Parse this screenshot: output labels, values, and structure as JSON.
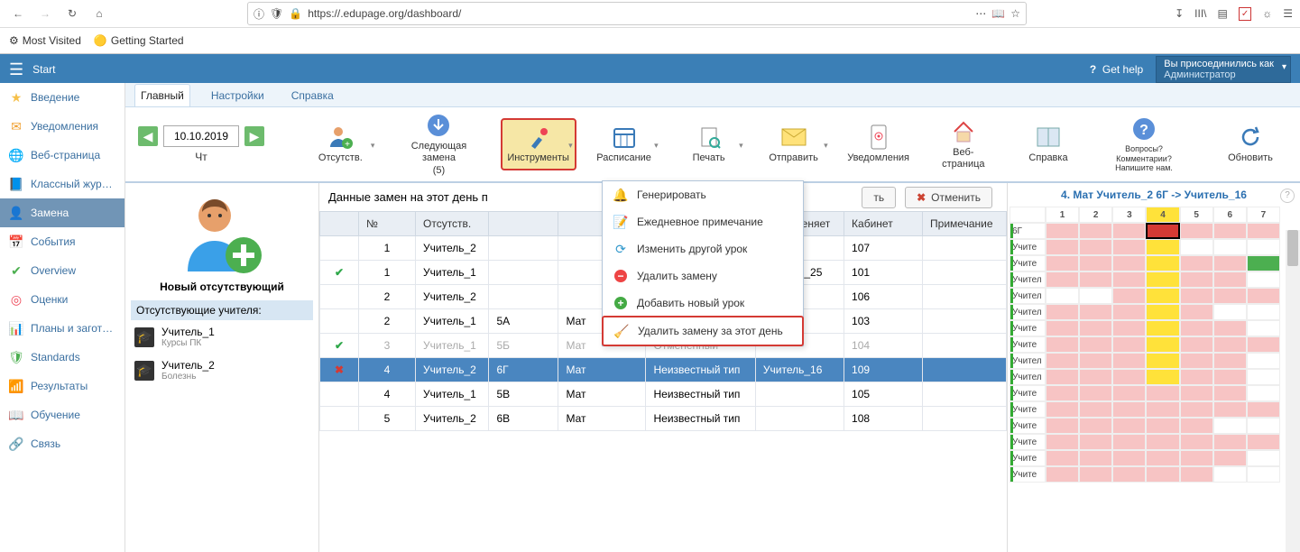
{
  "browser": {
    "url": "https://.edupage.org/dashboard/",
    "bookmarks": [
      "Most Visited",
      "Getting Started"
    ]
  },
  "header": {
    "start": "Start",
    "help": "Get help",
    "joined_as": "Вы присоединились как",
    "role": "Администратор"
  },
  "sidebar": [
    {
      "icon": "star",
      "label": "Введение",
      "color": "#f6c04a"
    },
    {
      "icon": "mail",
      "label": "Уведомления",
      "color": "#f0a030"
    },
    {
      "icon": "globe",
      "label": "Веб-страница",
      "color": "#3aa0e8"
    },
    {
      "icon": "book",
      "label": "Классный жур…",
      "color": "#3a7fd8"
    },
    {
      "icon": "user",
      "label": "Замена",
      "color": "#fff",
      "active": true
    },
    {
      "icon": "cal",
      "label": "События",
      "color": "#3a7fd8"
    },
    {
      "icon": "check",
      "label": "Overview",
      "color": "#4caf50"
    },
    {
      "icon": "target",
      "label": "Оценки",
      "color": "#e45"
    },
    {
      "icon": "plan",
      "label": "Планы и загот…",
      "color": "#3a9ad8"
    },
    {
      "icon": "shield",
      "label": "Standards",
      "color": "#4caf50"
    },
    {
      "icon": "bars",
      "label": "Результаты",
      "color": "#3a7fd8"
    },
    {
      "icon": "learn",
      "label": "Обучение",
      "color": "#3aa0e8"
    },
    {
      "icon": "link",
      "label": "Связь",
      "color": "#4caf50"
    }
  ],
  "tabs": [
    "Главный",
    "Настройки",
    "Справка"
  ],
  "toolbar": {
    "date": "10.10.2019",
    "day": "Чт",
    "absence": "Отсутств.",
    "next_sub": "Следующая замена",
    "next_sub_count": "(5)",
    "tools": "Инструменты",
    "schedule": "Расписание",
    "print": "Печать",
    "send": "Отправить",
    "notifications": "Уведомления",
    "webpage": "Веб-страница",
    "help": "Справка",
    "faq": "Вопросы? Комментарии? Напишите нам.",
    "refresh": "Обновить"
  },
  "dropdown": [
    {
      "icon": "🔔",
      "label": "Генерировать",
      "color": "#e06"
    },
    {
      "icon": "📝",
      "label": "Ежедневное примечание",
      "color": "#6aa"
    },
    {
      "icon": "⟳",
      "label": "Изменить другой урок",
      "color": "#39c"
    },
    {
      "icon": "−",
      "label": "Удалить замену",
      "color": "#e44",
      "circle": true
    },
    {
      "icon": "+",
      "label": "Добавить новый урок",
      "color": "#4a4",
      "circle": true
    },
    {
      "icon": "🧹",
      "label": "Удалить замену за этот день",
      "color": "#59c",
      "hl": true
    }
  ],
  "left": {
    "new_absent": "Новый отсутствующий",
    "absent_header": "Отсутствующие учителя:",
    "absent": [
      {
        "name": "Учитель_1",
        "sub": "Курсы ПК"
      },
      {
        "name": "Учитель_2",
        "sub": "Болезнь"
      }
    ]
  },
  "table": {
    "message_prefix": "Данные замен на этот день п",
    "save": "ть",
    "cancel": "Отменить",
    "headers": [
      "",
      "№",
      "Отсутств.",
      "",
      "",
      "Тип замены",
      "Кто заменяет",
      "Кабинет",
      "Примечание"
    ],
    "rows": [
      {
        "status": "",
        "n": "1",
        "absent": "Учитель_2",
        "cls": "",
        "subj": "",
        "type": "Неизвестный тип",
        "who": "",
        "room": "107",
        "note": ""
      },
      {
        "status": "ok",
        "n": "1",
        "absent": "Учитель_1",
        "cls": "",
        "subj": "",
        "type": "",
        "who": "Учитель_25",
        "room": "101",
        "note": ""
      },
      {
        "status": "",
        "n": "2",
        "absent": "Учитель_2",
        "cls": "",
        "subj": "",
        "type": "Неизвестный тип",
        "who": "",
        "room": "106",
        "note": ""
      },
      {
        "status": "",
        "n": "2",
        "absent": "Учитель_1",
        "cls": "5А",
        "subj": "Мат",
        "type": "Неизвестный тип",
        "who": "",
        "room": "103",
        "note": ""
      },
      {
        "status": "ok",
        "n": "3",
        "absent": "Учитель_1",
        "cls": "5Б",
        "subj": "Мат",
        "type": "Отменённый",
        "who": "",
        "room": "104",
        "note": "",
        "cancelled": true
      },
      {
        "status": "x",
        "n": "4",
        "absent": "Учитель_2",
        "cls": "6Г",
        "subj": "Мат",
        "type": "Неизвестный тип",
        "who": "Учитель_16",
        "room": "109",
        "note": "",
        "selected": true
      },
      {
        "status": "",
        "n": "4",
        "absent": "Учитель_1",
        "cls": "5В",
        "subj": "Мат",
        "type": "Неизвестный тип",
        "who": "",
        "room": "105",
        "note": ""
      },
      {
        "status": "",
        "n": "5",
        "absent": "Учитель_2",
        "cls": "6В",
        "subj": "Мат",
        "type": "Неизвестный тип",
        "who": "",
        "room": "108",
        "note": ""
      }
    ]
  },
  "right": {
    "title": "4. Мат Учитель_2 6Г -> Учитель_16",
    "cols": [
      "1",
      "2",
      "3",
      "4",
      "5",
      "6",
      "7"
    ],
    "rows": [
      {
        "label": "6Г",
        "cells": [
          "pink",
          "pink",
          "pink",
          "red",
          "pink",
          "pink",
          "pink"
        ]
      },
      {
        "label": "Учите",
        "cells": [
          "pink",
          "pink",
          "pink",
          "ylw",
          "wht",
          "wht",
          "wht"
        ]
      },
      {
        "label": "Учите",
        "cells": [
          "pink",
          "pink",
          "pink",
          "ylw",
          "pink",
          "pink",
          "grn"
        ]
      },
      {
        "label": "Учител",
        "cells": [
          "pink",
          "pink",
          "pink",
          "ylw",
          "pink",
          "pink",
          "wht"
        ]
      },
      {
        "label": "Учител",
        "cells": [
          "wht",
          "wht",
          "pink",
          "ylw",
          "pink",
          "pink",
          "pink"
        ]
      },
      {
        "label": "Учител",
        "cells": [
          "pink",
          "pink",
          "pink",
          "ylw",
          "pink",
          "wht",
          "wht"
        ]
      },
      {
        "label": "Учите",
        "cells": [
          "pink",
          "pink",
          "pink",
          "ylw",
          "pink",
          "pink",
          "wht"
        ]
      },
      {
        "label": "Учите",
        "cells": [
          "pink",
          "pink",
          "pink",
          "ylw",
          "pink",
          "pink",
          "pink"
        ]
      },
      {
        "label": "Учител",
        "cells": [
          "pink",
          "pink",
          "pink",
          "ylw",
          "pink",
          "pink",
          "wht"
        ]
      },
      {
        "label": "Учител",
        "cells": [
          "pink",
          "pink",
          "pink",
          "ylw",
          "pink",
          "pink",
          "wht"
        ]
      },
      {
        "label": "Учите",
        "cells": [
          "pink",
          "pink",
          "pink",
          "pink",
          "pink",
          "pink",
          "wht"
        ]
      },
      {
        "label": "Учите",
        "cells": [
          "pink",
          "pink",
          "pink",
          "pink",
          "pink",
          "pink",
          "pink"
        ]
      },
      {
        "label": "Учите",
        "cells": [
          "pink",
          "pink",
          "pink",
          "pink",
          "pink",
          "wht",
          "wht"
        ]
      },
      {
        "label": "Учите",
        "cells": [
          "pink",
          "pink",
          "pink",
          "pink",
          "pink",
          "pink",
          "pink"
        ]
      },
      {
        "label": "Учите",
        "cells": [
          "pink",
          "pink",
          "pink",
          "pink",
          "pink",
          "pink",
          "wht"
        ]
      },
      {
        "label": "Учите",
        "cells": [
          "pink",
          "pink",
          "pink",
          "pink",
          "pink",
          "wht",
          "wht"
        ]
      }
    ]
  }
}
